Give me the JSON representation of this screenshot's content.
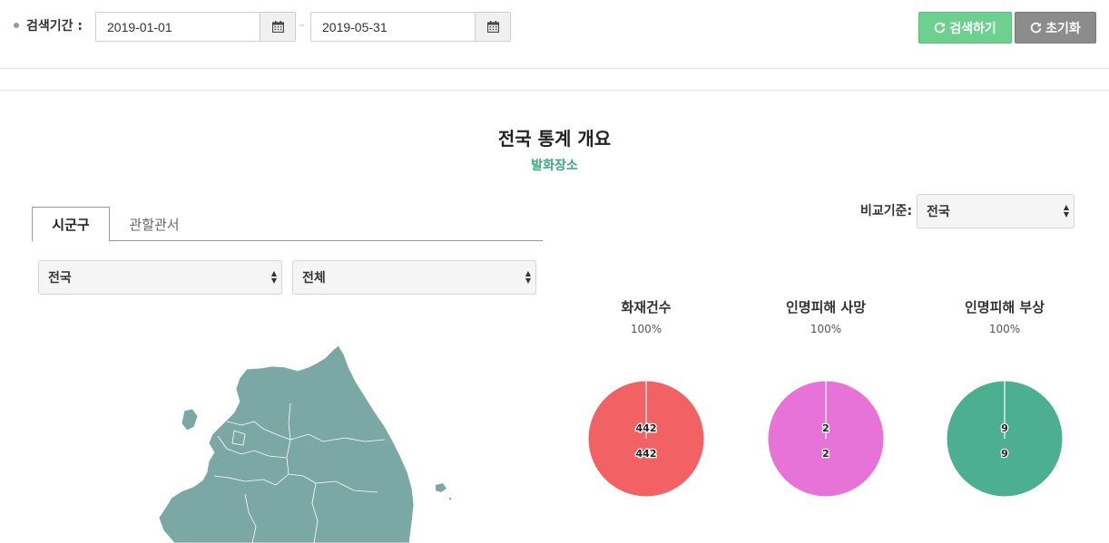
{
  "search": {
    "label": "검색기간 :",
    "start_date": "2019-01-01",
    "end_date": "2019-05-31",
    "separator": "–",
    "search_button": "검색하기",
    "reset_button": "초기화"
  },
  "header": {
    "title": "전국 통계 개요",
    "subtitle": "발화장소"
  },
  "tabs": [
    {
      "label": "시군구",
      "active": true
    },
    {
      "label": "관할관서",
      "active": false
    }
  ],
  "filters": {
    "region_value": "전국",
    "sub_value": "전체",
    "compare_label": "비교기준:",
    "compare_value": "전국"
  },
  "colors": {
    "search_btn": "#6ed08e",
    "reset_btn": "#8c8c8c",
    "accent_green": "#3aa880",
    "map_fill": "#7ba7a5"
  },
  "chart_data": [
    {
      "type": "pie",
      "title": "화재건수",
      "percent_label": "100%",
      "values": [
        442
      ],
      "labels": [
        "442",
        "442"
      ],
      "color": "#f26164"
    },
    {
      "type": "pie",
      "title": "인명피해 사망",
      "percent_label": "100%",
      "values": [
        2
      ],
      "labels": [
        "2",
        "2"
      ],
      "color": "#e873d8"
    },
    {
      "type": "pie",
      "title": "인명피해 부상",
      "percent_label": "100%",
      "values": [
        9
      ],
      "labels": [
        "9",
        "9"
      ],
      "color": "#4caf8f"
    }
  ]
}
